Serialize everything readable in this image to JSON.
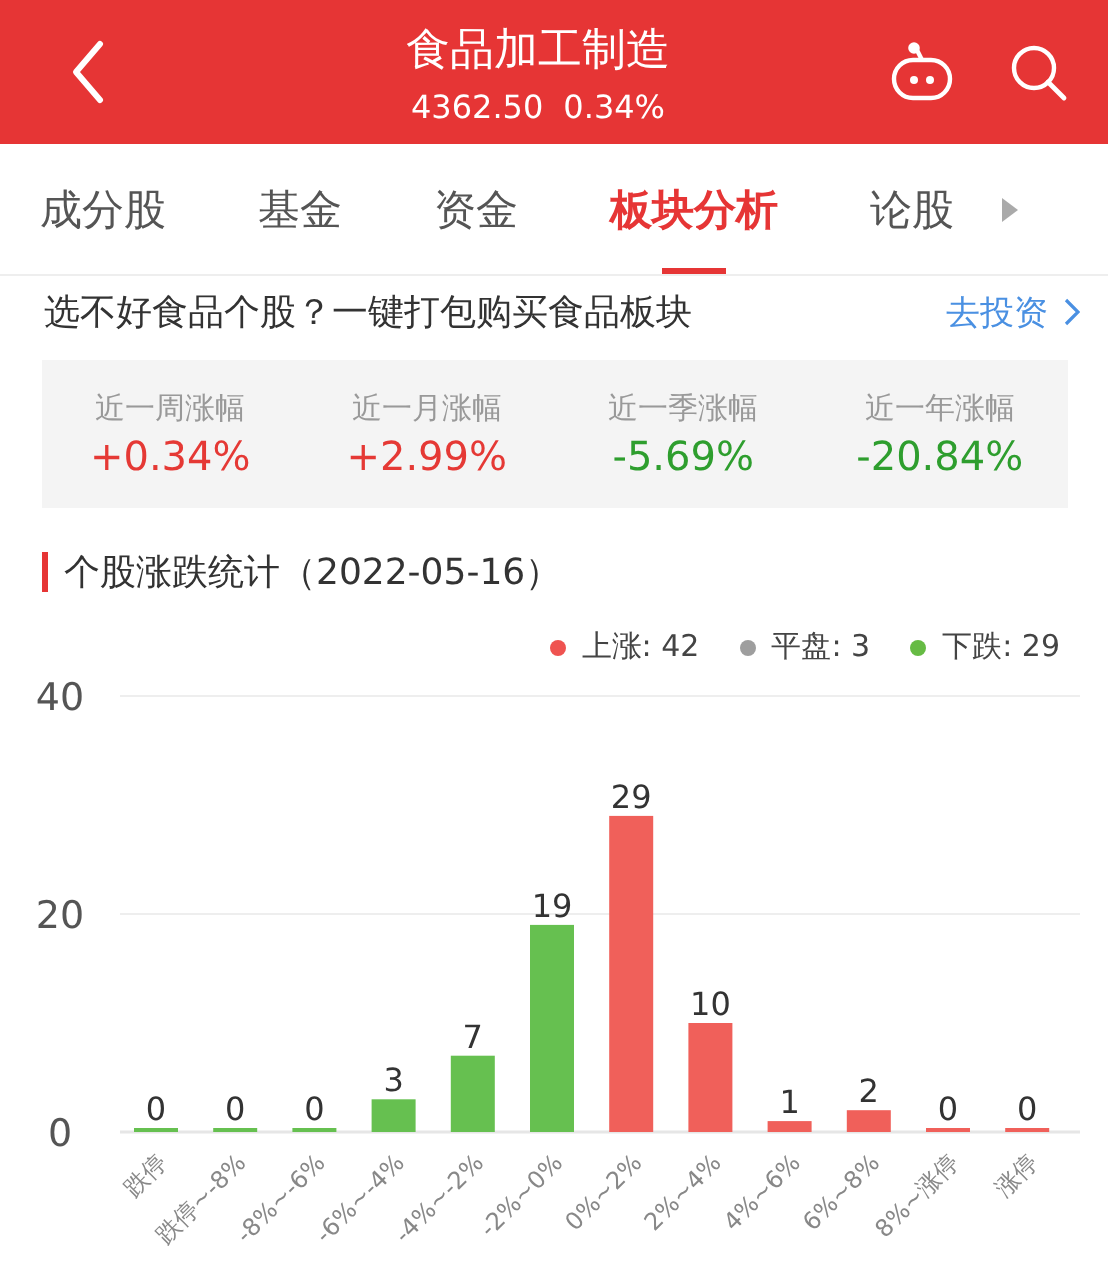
{
  "header": {
    "title": "食品加工制造",
    "price": "4362.50",
    "change": "0.34%"
  },
  "tabs": [
    {
      "label": "成分股",
      "selected": false
    },
    {
      "label": "基金",
      "selected": false
    },
    {
      "label": "资金",
      "selected": false
    },
    {
      "label": "板块分析",
      "selected": true
    },
    {
      "label": "论股",
      "selected": false
    }
  ],
  "promo": {
    "text": "选不好食品个股？一键打包购买食品板块",
    "link": "去投资"
  },
  "stats": [
    {
      "label": "近一周涨幅",
      "value": "+0.34%",
      "color": "#e53935"
    },
    {
      "label": "近一月涨幅",
      "value": "+2.99%",
      "color": "#e53935"
    },
    {
      "label": "近一季涨幅",
      "value": "-5.69%",
      "color": "#2e9e2e"
    },
    {
      "label": "近一年涨幅",
      "value": "-20.84%",
      "color": "#2e9e2e"
    }
  ],
  "section_title": "个股涨跌统计（2022-05-16）",
  "legend": [
    {
      "label": "上涨: 42",
      "color": "#ef5350"
    },
    {
      "label": "平盘: 3",
      "color": "#9e9e9e"
    },
    {
      "label": "下跌: 29",
      "color": "#66bb44"
    }
  ],
  "chart_data": {
    "type": "bar",
    "categories": [
      "跌停",
      "跌停~-8%",
      "-8%~-6%",
      "-6%~-4%",
      "-4%~-2%",
      "-2%~0%",
      "0%~2%",
      "2%~4%",
      "4%~6%",
      "6%~8%",
      "8%~涨停",
      "涨停"
    ],
    "series": [
      {
        "color": "#66c050",
        "values": [
          0,
          0,
          0,
          3,
          7,
          19,
          null,
          null,
          null,
          null,
          null,
          null
        ]
      },
      {
        "color": "#f0605a",
        "values": [
          null,
          null,
          null,
          null,
          null,
          null,
          29,
          10,
          1,
          2,
          0,
          0
        ]
      }
    ],
    "ylim": [
      0,
      40
    ],
    "yticks": [
      0,
      20,
      40
    ],
    "data_labels": true
  }
}
